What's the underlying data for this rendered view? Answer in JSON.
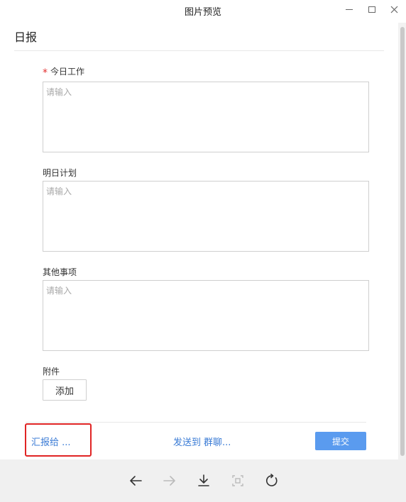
{
  "window": {
    "title": "图片预览"
  },
  "page": {
    "title": "日报"
  },
  "fields": [
    {
      "label": "今日工作",
      "required_mark": "*",
      "placeholder": "请输入",
      "value": ""
    },
    {
      "label": "明日计划",
      "placeholder": "请输入",
      "value": ""
    },
    {
      "label": "其他事项",
      "placeholder": "请输入",
      "value": ""
    }
  ],
  "attachment": {
    "label": "附件",
    "add_label": "添加"
  },
  "footer": {
    "report_to": "汇报给 ...",
    "send_to": "发送到",
    "group_chat": "群聊...",
    "submit": "提交"
  },
  "colors": {
    "link": "#3a7bd5",
    "submit_bg": "#5a9bef",
    "highlight": "#e02424",
    "required": "#e32e2e"
  },
  "toolbar": {
    "icons": [
      "back-arrow-icon",
      "forward-arrow-icon",
      "download-icon",
      "fit-screen-icon",
      "rotate-icon"
    ]
  }
}
